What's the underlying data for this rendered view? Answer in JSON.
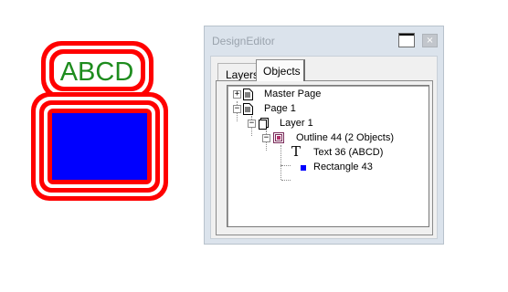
{
  "artwork": {
    "text": "ABCD",
    "text_color": "#1e8c1e",
    "outline_color": "#ff0000",
    "rect_color": "#0000ff"
  },
  "window": {
    "title": "DesignEditor",
    "close_glyph": "×",
    "tabs": [
      {
        "label": "Layers",
        "active": false
      },
      {
        "label": "Objects",
        "active": true
      }
    ],
    "tree": [
      {
        "label": "Master Page",
        "expander": "+",
        "icon": "page-icon"
      },
      {
        "label": "Page 1",
        "expander": "−",
        "icon": "page-icon"
      },
      {
        "label": "Layer 1",
        "expander": "−",
        "icon": "layer-icon"
      },
      {
        "label": "Outline 44 (2 Objects)",
        "expander": "−",
        "icon": "outline-group-icon"
      },
      {
        "label": "Text 36 (ABCD)",
        "icon": "text-tool-icon",
        "icon_glyph": "T"
      },
      {
        "label": "Rectangle 43",
        "icon": "rectangle-icon",
        "icon_color": "#0000ff"
      }
    ]
  }
}
